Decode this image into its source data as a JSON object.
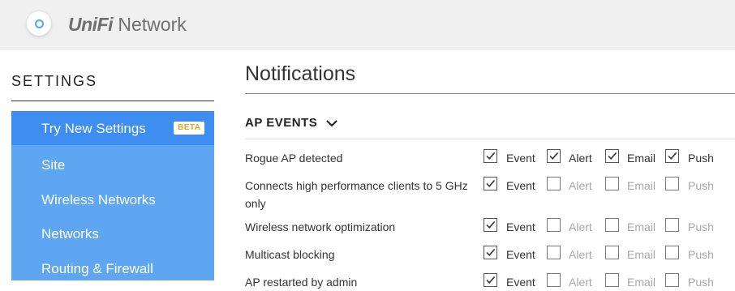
{
  "header": {
    "brand_bold": "UniFi",
    "brand_rest": " Network"
  },
  "sidebar": {
    "title": "SETTINGS",
    "items": [
      {
        "label": "Try New Settings",
        "badge": "BETA",
        "active": true
      },
      {
        "label": "Site"
      },
      {
        "label": "Wireless Networks"
      },
      {
        "label": "Networks"
      },
      {
        "label": "Routing & Firewall"
      }
    ]
  },
  "main": {
    "title": "Notifications",
    "section": "AP EVENTS",
    "columns": [
      "Event",
      "Alert",
      "Email",
      "Push"
    ],
    "events": [
      {
        "name": "Rogue AP detected",
        "checked": [
          true,
          true,
          true,
          true
        ]
      },
      {
        "name": "Connects high performance clients to 5 GHz only",
        "checked": [
          true,
          false,
          false,
          false
        ]
      },
      {
        "name": "Wireless network optimization",
        "checked": [
          true,
          false,
          false,
          false
        ]
      },
      {
        "name": "Multicast blocking",
        "checked": [
          true,
          false,
          false,
          false
        ]
      },
      {
        "name": "AP restarted by admin",
        "checked": [
          true,
          false,
          false,
          false
        ]
      }
    ]
  }
}
